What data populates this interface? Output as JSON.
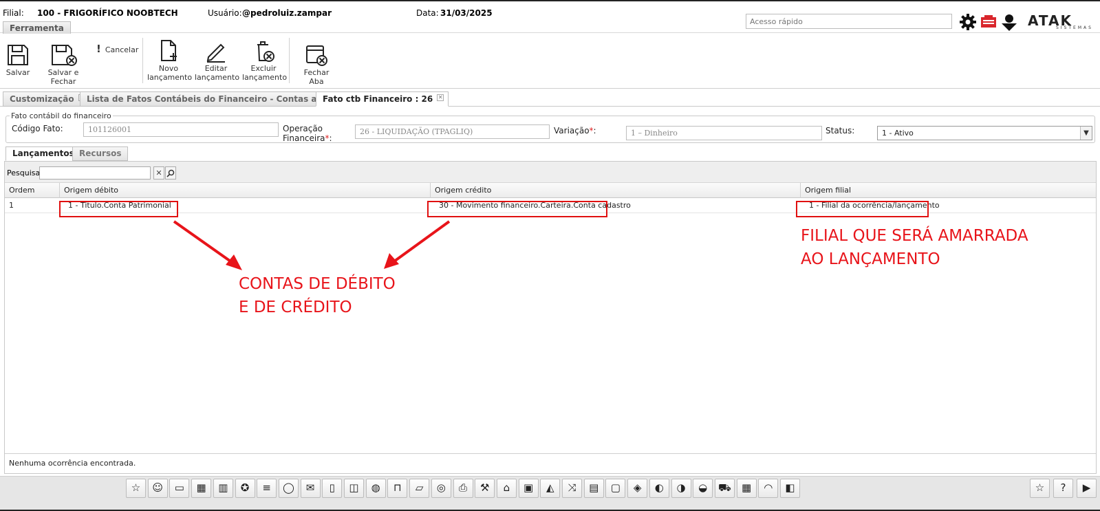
{
  "header": {
    "filial_label": "Filial:",
    "filial_value": "100 - FRIGORÍFICO NOOBTECH",
    "usuario_label": "Usuário:",
    "usuario_value": "@pedroluiz.zampar",
    "data_label": "Data:",
    "data_value": "31/03/2025",
    "ferramenta_tab": "Ferramenta",
    "quick_access_placeholder": "Acesso rápido",
    "logo_text": "ATAK",
    "logo_sub": "SISTEMAS"
  },
  "toolbar": {
    "salvar": "Salvar",
    "salvar_fechar": "Salvar e Fechar",
    "cancelar": "Cancelar",
    "novo_1": "Novo",
    "novo_2": "lançamento",
    "editar_1": "Editar",
    "editar_2": "lançamento",
    "excluir_1": "Excluir",
    "excluir_2": "lançamento",
    "fechar_aba": "Fechar Aba"
  },
  "tabs": [
    {
      "label": "Customização"
    },
    {
      "label": "Lista de Fatos Contábeis do Financeiro - Contas a Pagar"
    },
    {
      "label": "Fato ctb Financeiro : 26"
    }
  ],
  "form": {
    "legend": "Fato contábil do financeiro",
    "codigo_label": "Código Fato:",
    "codigo_value": "101126001",
    "operacao_label_1": "Operação",
    "operacao_label_2": "Financeira",
    "operacao_value": "26 - LIQUIDAÇÃO (TPAGLIQ)",
    "variacao_label": "Variação",
    "variacao_value": "1 – Dinheiro",
    "status_label": "Status:",
    "status_value": "1 - Ativo",
    "required_mark": "*",
    "colon": ":"
  },
  "subtabs": [
    {
      "label": "Lançamentos"
    },
    {
      "label": "Recursos"
    }
  ],
  "grid": {
    "search_label": "Pesquisar",
    "columns": [
      "Ordem",
      "Origem débito",
      "Origem crédito",
      "Origem filial"
    ],
    "rows": [
      [
        "1",
        "1 - Titulo.Conta Patrimonial",
        "30 - Movimento financeiro.Carteira.Conta cadastro",
        "1 - Filial da ocorrência/lançamento"
      ]
    ],
    "status_text": "Nenhuma ocorrência encontrada."
  },
  "annotations": {
    "contas_line1": "CONTAS DE DÉBITO",
    "contas_line2": "E DE CRÉDITO",
    "filial_line1": "FILIAL QUE SERÁ AMARRADA",
    "filial_line2": "AO LANÇAMENTO",
    "color": "#e8141a"
  },
  "bottom_icons": [
    "star-icon",
    "people-icon",
    "briefcase-icon",
    "calculator-icon",
    "barcode-icon",
    "badge-icon",
    "sliders-icon",
    "mouse-icon",
    "mail-icon",
    "book-icon",
    "box-icon",
    "globe-icon",
    "bottle-icon",
    "truck-icon",
    "coins-icon",
    "printer-icon",
    "tools-icon",
    "factory-icon",
    "tank-icon",
    "car-icon",
    "shuffle-icon",
    "payment-icon",
    "document-icon",
    "handshake-icon",
    "globe-money-icon",
    "globe-check-icon",
    "globe-x-icon",
    "cart-icon",
    "table-icon",
    "headset-icon",
    "boxes-icon"
  ],
  "right_icons": [
    "star-add-icon",
    "help-icon",
    "play-icon"
  ]
}
